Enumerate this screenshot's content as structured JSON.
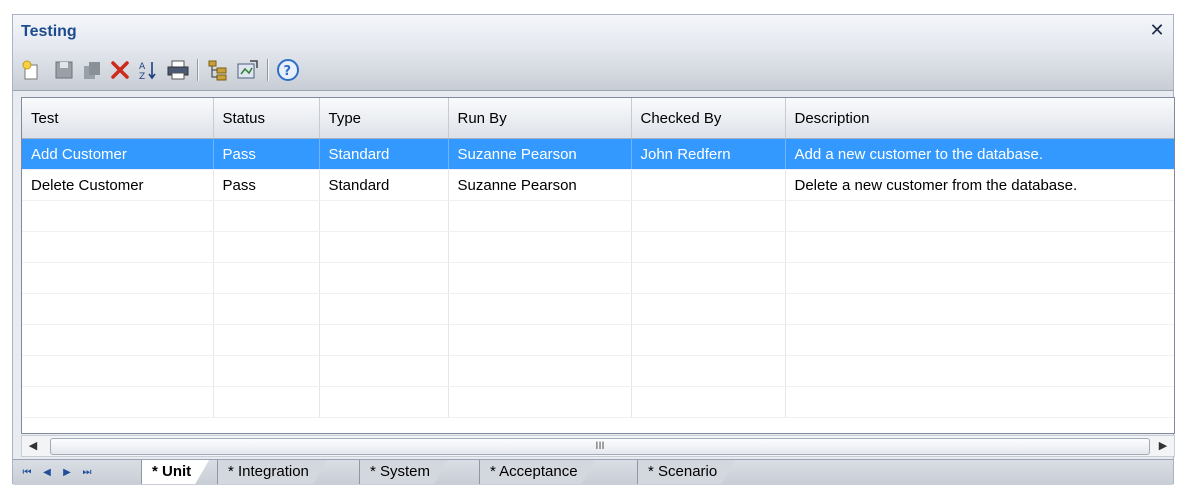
{
  "window": {
    "title": "Testing",
    "close_glyph": "✕"
  },
  "toolbar": {
    "icons": [
      "new-test-icon",
      "save-icon",
      "copy-icon",
      "delete-icon",
      "sort-icon",
      "print-icon",
      "tree-view-icon",
      "export-icon",
      "help-icon"
    ],
    "delete_color": "#cc2a1a",
    "help_color": "#2f6fc7"
  },
  "table": {
    "columns": [
      "Test",
      "Status",
      "Type",
      "Run By",
      "Checked By",
      "Description"
    ],
    "rows": [
      {
        "test": "Add Customer",
        "status": "Pass",
        "type": "Standard",
        "run_by": "Suzanne Pearson",
        "checked_by": "John Redfern",
        "description": "Add a new customer to the database."
      },
      {
        "test": "Delete Customer",
        "status": "Pass",
        "type": "Standard",
        "run_by": "Suzanne Pearson",
        "checked_by": "",
        "description": "Delete a new customer from the database."
      }
    ],
    "selected_color": "#3399ff"
  },
  "scrollbar": {
    "left_glyph": "◀",
    "right_glyph": "▶",
    "grip_glyph": "III"
  },
  "tabs": {
    "items": [
      "* Unit",
      "* Integration",
      "* System",
      "* Acceptance",
      "* Scenario"
    ],
    "active": "* Unit"
  },
  "nav_glyphs": {
    "first": "⏮",
    "prev": "◀",
    "next": "▶",
    "last": "⏭"
  }
}
